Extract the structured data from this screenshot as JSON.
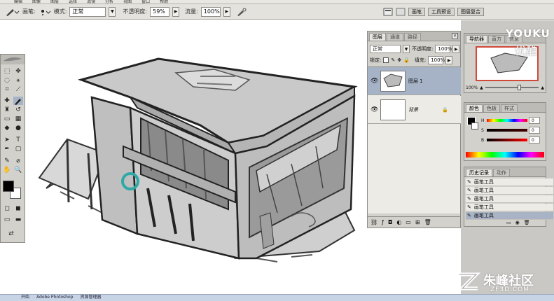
{
  "menubar": {
    "items": [
      "编辑",
      "图像",
      "图层",
      "选择",
      "滤镜",
      "分析",
      "视图",
      "窗口",
      "帮助"
    ]
  },
  "options": {
    "brush_label": "画笔:",
    "mode_label": "模式:",
    "mode_value": "正常",
    "opacity_label": "不透明度:",
    "opacity_value": "59%",
    "flow_label": "流量:",
    "flow_value": "100%",
    "dock_tabs": [
      "画笔",
      "工具预设",
      "图层复合"
    ]
  },
  "layers_panel": {
    "tabs": [
      "图层",
      "通道",
      "路径"
    ],
    "blend_mode": "正常",
    "opacity_label": "不透明度:",
    "opacity_value": "100%",
    "lock_label": "锁定:",
    "fill_label": "填充:",
    "fill_value": "100%",
    "layers": [
      {
        "name": "图层 1",
        "selected": true
      },
      {
        "name": "背景",
        "selected": false
      }
    ]
  },
  "navigator_panel": {
    "tabs": [
      "导航器",
      "直方",
      "信息"
    ],
    "zoom_value": "100%"
  },
  "color_panel": {
    "tabs": [
      "颜色",
      "色板",
      "样式"
    ],
    "channels": [
      {
        "label": "H",
        "value": "0"
      },
      {
        "label": "S",
        "value": "0"
      },
      {
        "label": "B",
        "value": "0"
      }
    ]
  },
  "history_panel": {
    "tabs": [
      "历史记录",
      "动作"
    ],
    "items": [
      "画笔工具",
      "画笔工具",
      "画笔工具",
      "画笔工具",
      "画笔工具"
    ]
  },
  "watermarks": {
    "youku_text": "YOUKU",
    "youku_sub": "优酷",
    "zf3d_text": "朱峰社区",
    "zf3d_url": "ZF3D.COM"
  },
  "taskbar": {
    "items": [
      "开始",
      "Adobe Photoshop",
      "资源管理器"
    ]
  },
  "colors": {
    "foreground": "#000000",
    "background": "#ffffff",
    "selection": "#a6b3c7",
    "cursor_teal": "#2fa9a6"
  }
}
